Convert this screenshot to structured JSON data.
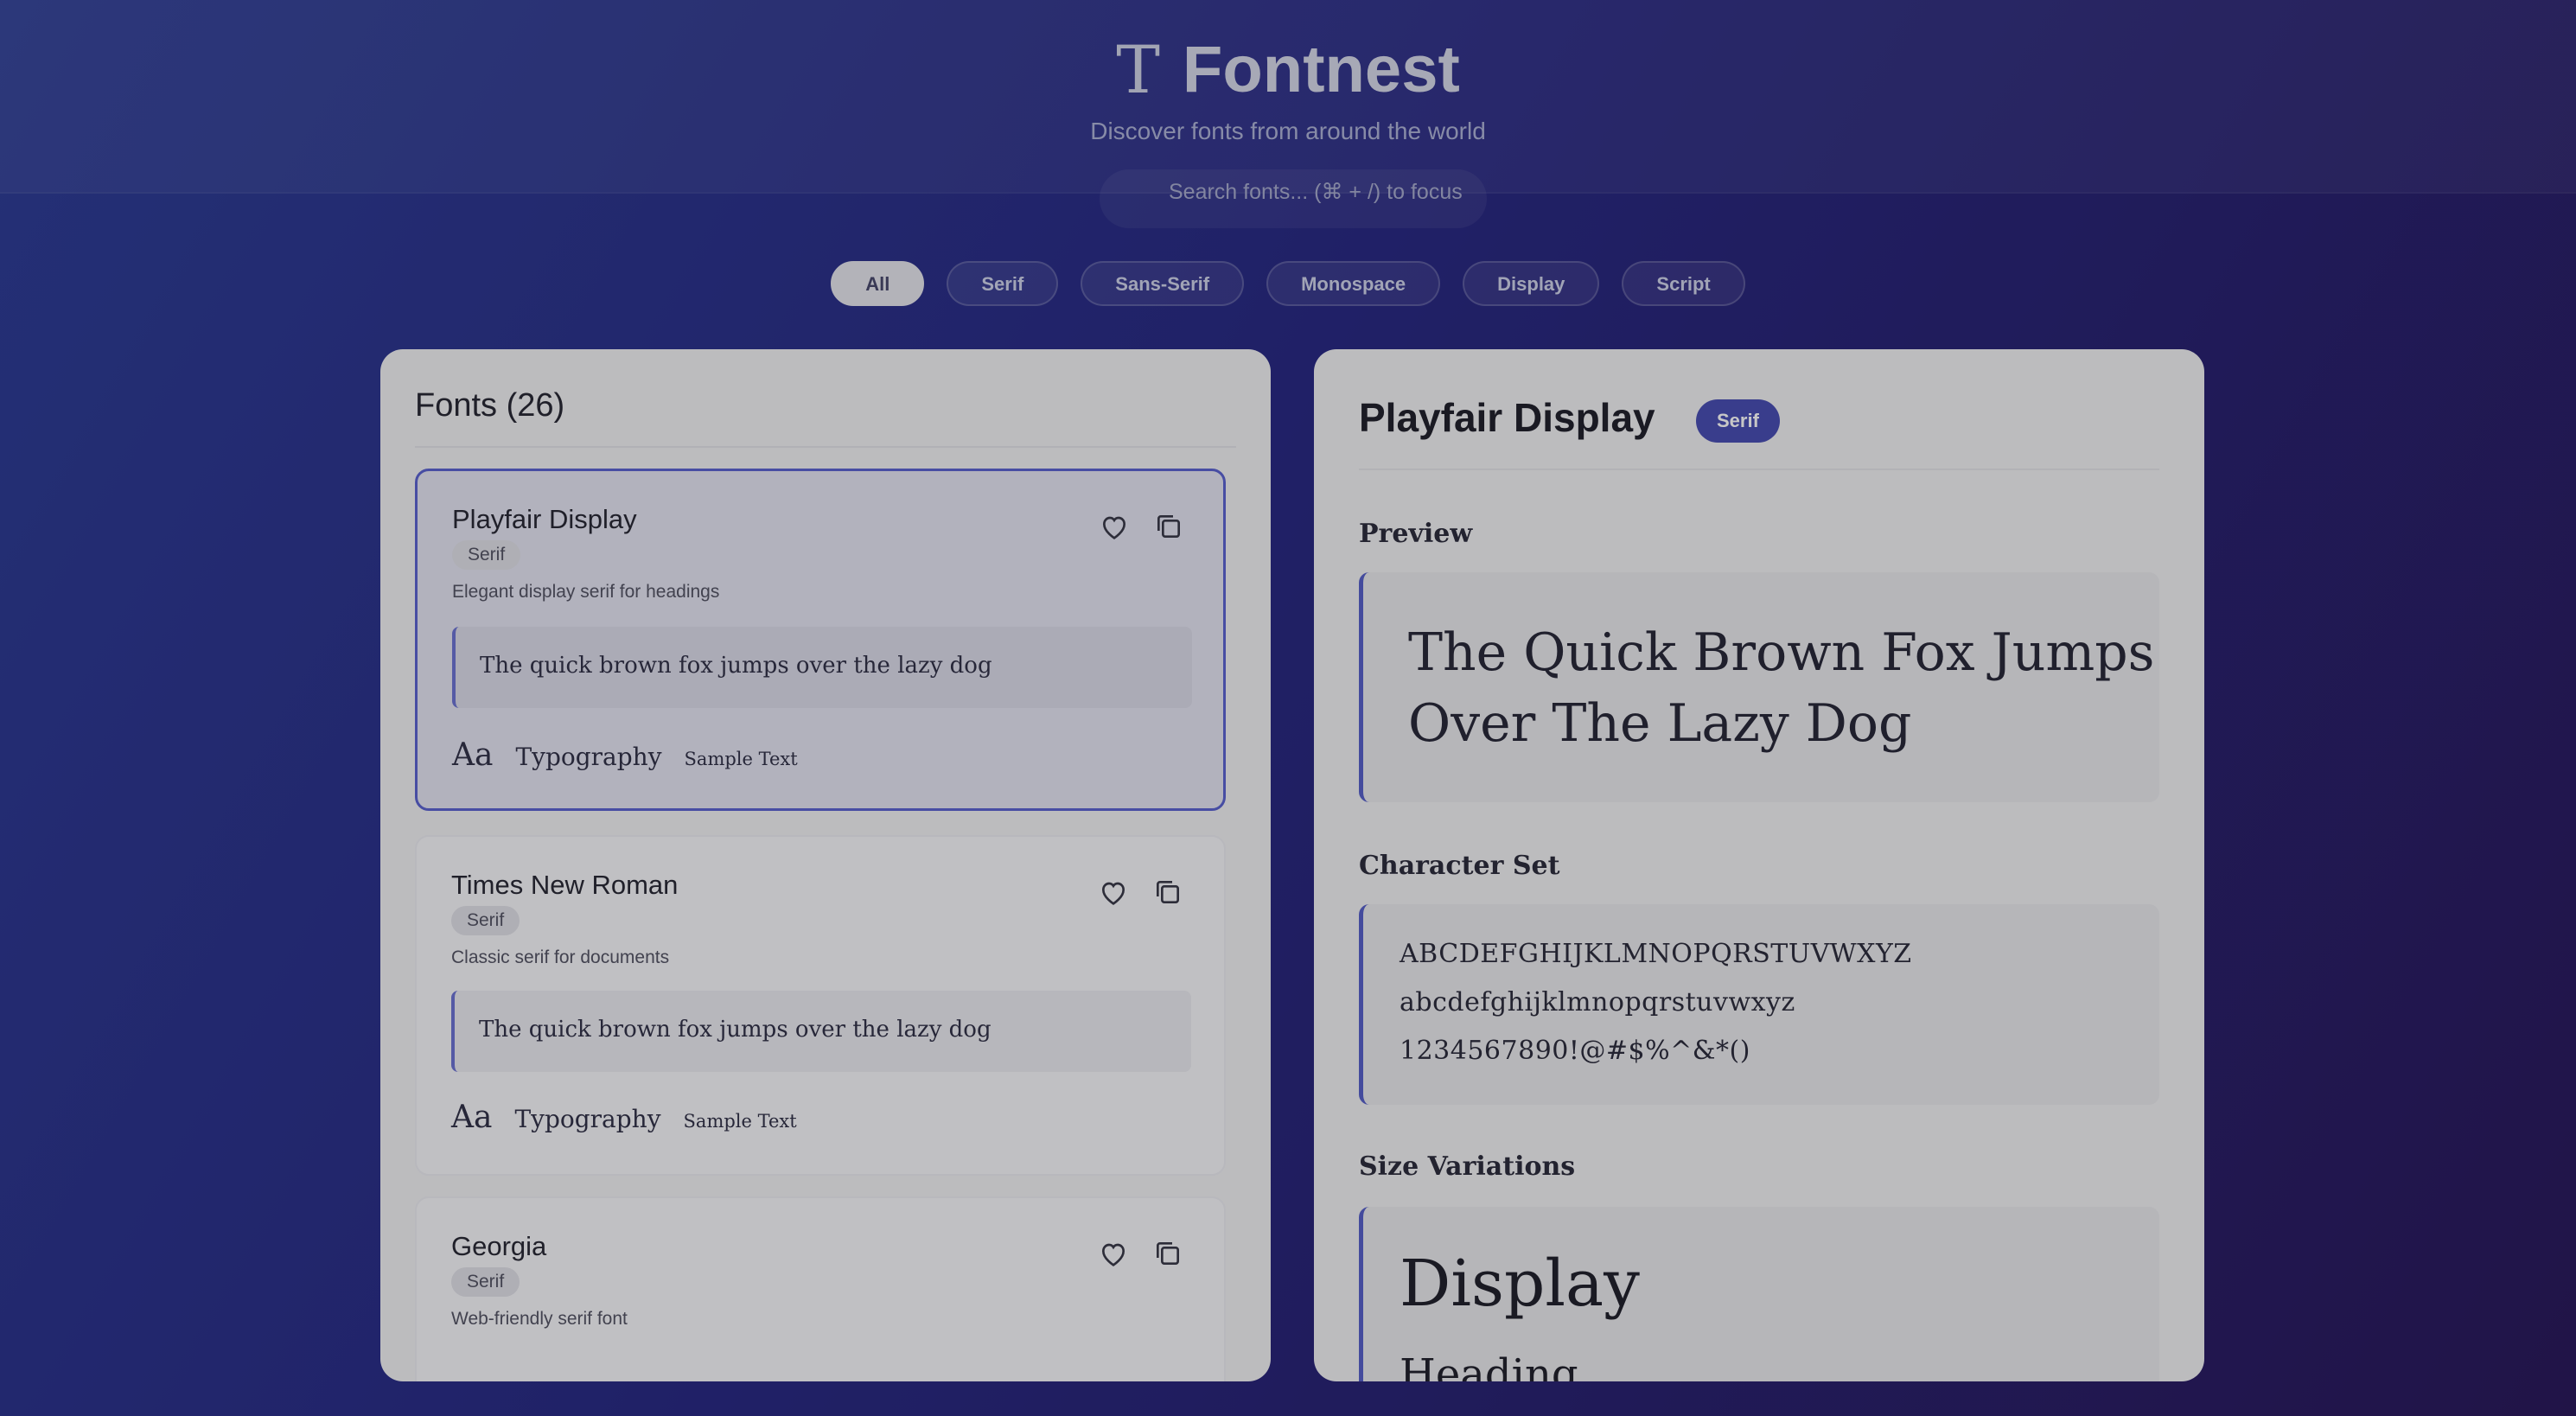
{
  "app": {
    "title": "Fontnest",
    "logo_glyph": "T",
    "subtitle": "Discover fonts from around the world"
  },
  "search": {
    "placeholder": "Search fonts... (⌘ + /) to focus"
  },
  "filters": [
    {
      "label": "All",
      "active": true
    },
    {
      "label": "Serif",
      "active": false
    },
    {
      "label": "Sans-Serif",
      "active": false
    },
    {
      "label": "Monospace",
      "active": false
    },
    {
      "label": "Display",
      "active": false
    },
    {
      "label": "Script",
      "active": false
    }
  ],
  "fonts_panel": {
    "heading": "Fonts (26)",
    "cards": [
      {
        "name": "Playfair Display",
        "category": "Serif",
        "description": "Elegant display serif for headings",
        "sample": "The quick brown fox jumps over the lazy dog",
        "specimen": {
          "aa": "Aa",
          "typography": "Typography",
          "sample_text": "Sample Text"
        },
        "selected": true
      },
      {
        "name": "Times New Roman",
        "category": "Serif",
        "description": "Classic serif for documents",
        "sample": "The quick brown fox jumps over the lazy dog",
        "specimen": {
          "aa": "Aa",
          "typography": "Typography",
          "sample_text": "Sample Text"
        },
        "selected": false
      },
      {
        "name": "Georgia",
        "category": "Serif",
        "description": "Web-friendly serif font",
        "selected": false
      }
    ]
  },
  "detail": {
    "name": "Playfair Display",
    "category": "Serif",
    "preview_label": "Preview",
    "preview_line1": "The Quick Brown Fox Jumps",
    "preview_line2": "Over The Lazy Dog",
    "charset_label": "Character Set",
    "charset_upper": "ABCDEFGHIJKLMNOPQRSTUVWXYZ",
    "charset_lower": "abcdefghijklmnopqrstuvwxyz",
    "charset_digits": "1234567890!@#$%^&*()",
    "sizes_label": "Size Variations",
    "size_display": "Display",
    "size_heading": "Heading"
  },
  "colors": {
    "accent": "#4a4fb4",
    "selected_border": "#5b63d1",
    "background_start": "#2f3f98",
    "background_end": "#2b1a5c"
  },
  "icons": [
    "heart-icon",
    "copy-icon",
    "type-logo-icon"
  ]
}
